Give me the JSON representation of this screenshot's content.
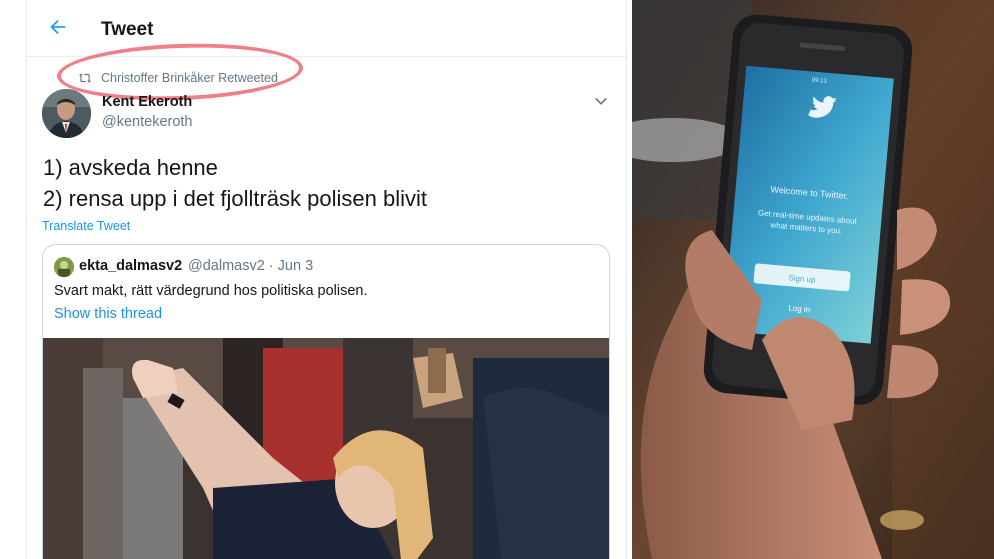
{
  "header": {
    "title": "Tweet"
  },
  "retweet": {
    "text": "Christoffer Brinkåker Retweeted"
  },
  "tweet": {
    "author_name": "Kent Ekeroth",
    "author_handle": "@kentekeroth",
    "line1": "1) avskeda henne",
    "line2": "2) rensa upp i det fjollträsk polisen blivit",
    "translate_label": "Translate Tweet"
  },
  "quote": {
    "name": "ekta_dalmasv2",
    "meta": "@dalmasv2 · Jun 3",
    "text": "Svart makt,  rätt värdegrund hos politiska polisen.",
    "thread_link": "Show this thread"
  },
  "phone": {
    "welcome": "Welcome to Twitter.",
    "tagline_1": "Get real-time updates about",
    "tagline_2": "what matters to you.",
    "signup": "Sign up",
    "login": "Log in",
    "time": "09:13"
  },
  "colors": {
    "twitter_blue": "#1b95e0",
    "muted_text": "#657786",
    "annotation_red": "#ec6a74"
  },
  "icons": [
    "back-arrow-icon",
    "retweet-icon",
    "chevron-down-icon",
    "twitter-bird-icon"
  ]
}
